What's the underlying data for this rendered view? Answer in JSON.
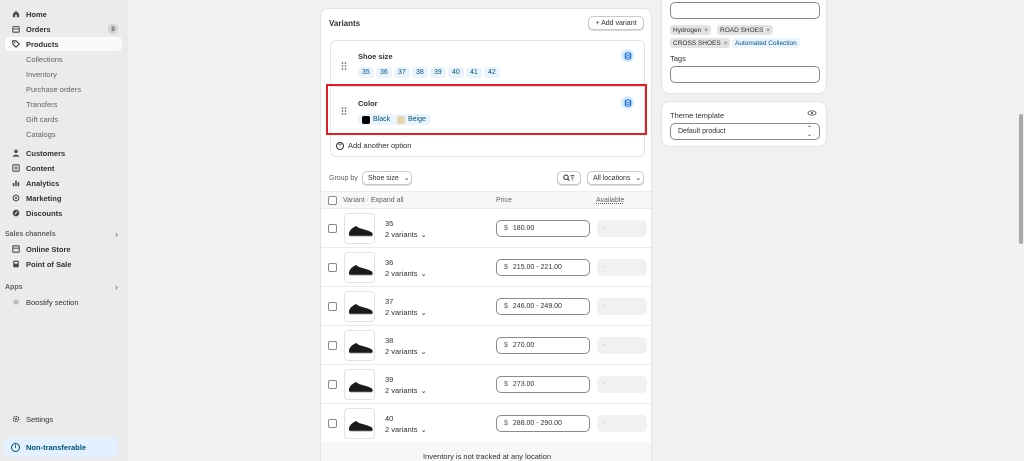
{
  "sidebar": {
    "items": [
      {
        "label": "Home",
        "icon": "home-icon"
      },
      {
        "label": "Orders",
        "icon": "orders-icon",
        "badge": "8"
      },
      {
        "label": "Products",
        "icon": "tag-icon"
      },
      {
        "label": "Collections"
      },
      {
        "label": "Inventory"
      },
      {
        "label": "Purchase orders"
      },
      {
        "label": "Transfers"
      },
      {
        "label": "Gift cards"
      },
      {
        "label": "Catalogs"
      },
      {
        "label": "Customers",
        "icon": "person-icon"
      },
      {
        "label": "Content",
        "icon": "content-icon"
      },
      {
        "label": "Analytics",
        "icon": "analytics-icon"
      },
      {
        "label": "Marketing",
        "icon": "marketing-icon"
      },
      {
        "label": "Discounts",
        "icon": "discount-icon"
      }
    ],
    "sales_channels_label": "Sales channels",
    "channels": [
      {
        "label": "Online Store",
        "icon": "store-icon"
      },
      {
        "label": "Point of Sale",
        "icon": "pos-icon"
      }
    ],
    "apps_label": "Apps",
    "apps": [
      {
        "label": "Boostify section"
      }
    ],
    "settings_label": "Settings",
    "non_transferable_label": "Non-transferable"
  },
  "variants": {
    "title": "Variants",
    "add_variant_label": "+ Add variant",
    "options": [
      {
        "name": "Shoe size",
        "values": [
          "35",
          "36",
          "37",
          "38",
          "39",
          "40",
          "41",
          "42"
        ]
      },
      {
        "name": "Color",
        "values": [
          {
            "label": "Black",
            "color": "#000000"
          },
          {
            "label": "Beige",
            "color": "#e8d5b0"
          }
        ]
      }
    ],
    "add_option_label": "Add another option",
    "group_by_label": "Group by",
    "group_by_value": "Shoe size",
    "locations_value": "All locations",
    "columns": {
      "variant": "Variant · Expand all",
      "price": "Price",
      "available": "Available"
    },
    "rows": [
      {
        "name": "35",
        "sub": "2 variants",
        "currency": "$",
        "price": "180.00",
        "available": "-"
      },
      {
        "name": "36",
        "sub": "2 variants",
        "currency": "$",
        "price": "215.00 - 221.00",
        "available": "-"
      },
      {
        "name": "37",
        "sub": "2 variants",
        "currency": "$",
        "price": "246.00 - 249.00",
        "available": "-"
      },
      {
        "name": "38",
        "sub": "2 variants",
        "currency": "$",
        "price": "270.00",
        "available": "-"
      },
      {
        "name": "39",
        "sub": "2 variants",
        "currency": "$",
        "price": "273.00",
        "available": "-"
      },
      {
        "name": "40",
        "sub": "2 variants",
        "currency": "$",
        "price": "288.00 - 290.00",
        "available": "-"
      }
    ],
    "footer_note": "Inventory is not tracked at any location"
  },
  "organization": {
    "tags_chips": [
      "Hydrogen",
      "ROAD SHOES",
      "CROSS SHOES",
      "Automated Collection"
    ],
    "tags_label": "Tags"
  },
  "theme": {
    "label": "Theme template",
    "value": "Default product"
  },
  "colors": {
    "accent_highlight": "#e51c23",
    "link_blue": "#00527c"
  }
}
